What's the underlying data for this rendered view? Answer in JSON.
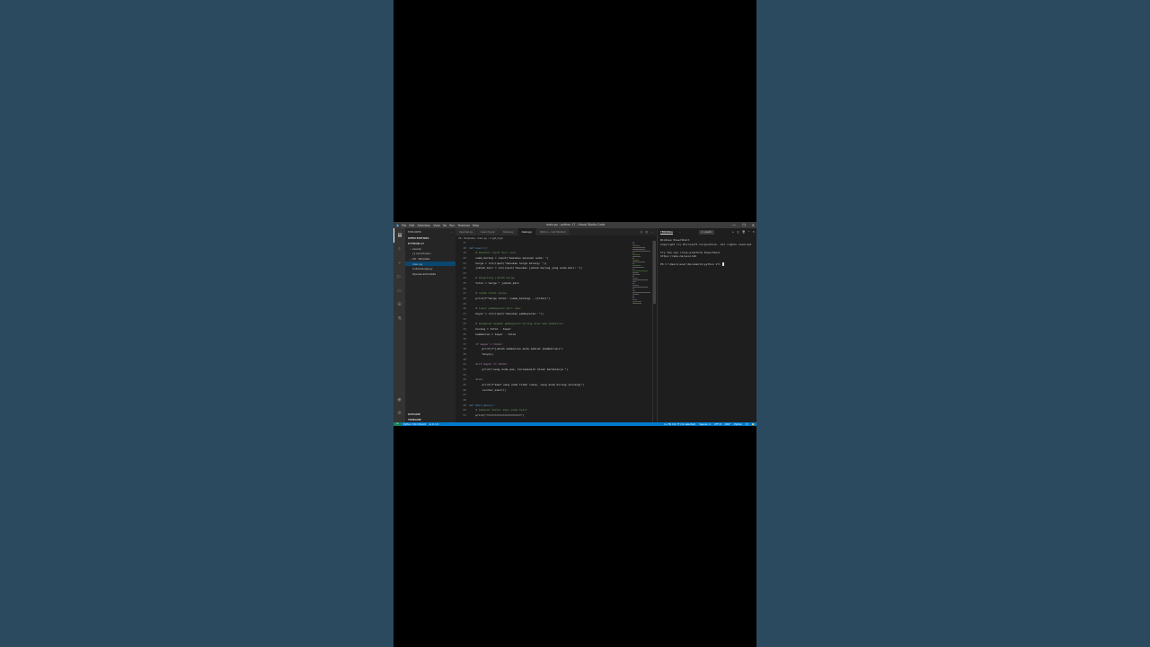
{
  "window": {
    "title": "main.py - python 17 - Visual Studio Code",
    "menu": [
      "File",
      "Edit",
      "Selection",
      "View",
      "Go",
      "Run",
      "Terminal",
      "Help"
    ],
    "controls": [
      "—",
      "❐",
      "✕"
    ]
  },
  "activity_bar": {
    "icons": [
      "explorer-icon",
      "search-icon",
      "source-control-icon",
      "run-debug-icon",
      "remote-explorer-icon",
      "extensions-icon",
      "testing-icon"
    ],
    "bottom_icons": [
      "account-icon",
      "gear-icon"
    ]
  },
  "sidebar": {
    "header": "EXPLORER",
    "header_action": "···",
    "sections": {
      "open_editors": "OPEN EDITORS",
      "workspace": "PYTHON 17",
      "outline": "OUTLINE",
      "timeline": "TIMELINE"
    },
    "tree": [
      {
        "label": "› .vscode",
        "selected": false
      },
      {
        "label": "{} launch.json",
        "selected": false
      },
      {
        "label": "⌄ 09 - Template",
        "selected": false
      },
      {
        "label": "main.py",
        "selected": true
      },
      {
        "label": "mulaimengai.py",
        "selected": false
      },
      {
        "label": "Operasi aritmatika",
        "selected": false
      }
    ]
  },
  "editor": {
    "tabs": [
      {
        "label": "desimal.py",
        "active": false
      },
      {
        "label": "launch.json",
        "active": false
      },
      {
        "label": "tabel.py",
        "active": false
      },
      {
        "label": "main.py",
        "active": true
      },
      {
        "label": "Python - Get Started",
        "active": false
      }
    ],
    "breadcrumb": "09 - Template › main.py › ⊙ get_login",
    "lines": [
      {
        "n": "17",
        "t": "",
        "c": "tx"
      },
      {
        "n": "18",
        "t": "def kasir():",
        "c": "df"
      },
      {
        "n": "19",
        "t": "    # masukan input dari user",
        "c": "cm"
      },
      {
        "n": "20",
        "t": "    nama_barang = input(\"masukan pesanan anda: \")",
        "c": "tx"
      },
      {
        "n": "21",
        "t": "    harga = int(input(\"masukan harga barang: \"))",
        "c": "tx"
      },
      {
        "n": "22",
        "t": "    jumlah_beli = int(input(\"masukan jumlah barang yang anda beli: \"))",
        "c": "tx"
      },
      {
        "n": "23",
        "t": "",
        "c": "tx"
      },
      {
        "n": "24",
        "t": "    # mengitung jumlah harga",
        "c": "cm"
      },
      {
        "n": "25",
        "t": "    total = harga * jumlah_beli",
        "c": "tx"
      },
      {
        "n": "26",
        "t": "",
        "c": "tx"
      },
      {
        "n": "27",
        "t": "    # cetak total harga",
        "c": "cm"
      },
      {
        "n": "28",
        "t": "    print(f\"harga total: {nama_barang} - {total}\")",
        "c": "tx"
      },
      {
        "n": "29",
        "t": "",
        "c": "tx"
      },
      {
        "n": "30",
        "t": "    # input pembayaran dari user",
        "c": "cm"
      },
      {
        "n": "31",
        "t": "    bayar = int(input(\"masukan pembayaran: \"))",
        "c": "tx"
      },
      {
        "n": "32",
        "t": "",
        "c": "tx"
      },
      {
        "n": "33",
        "t": "    # mengecek apakah pembayaran kurang atau ada kembalian",
        "c": "cm"
      },
      {
        "n": "34",
        "t": "    kurang = total - bayar",
        "c": "tx"
      },
      {
        "n": "35",
        "t": "    kembalian = bayar - total",
        "c": "tx"
      },
      {
        "n": "36",
        "t": "",
        "c": "tx"
      },
      {
        "n": "37",
        "t": "    if bayar > total:",
        "c": "kw"
      },
      {
        "n": "38",
        "t": "        print(f\"jumlah kembalian anda adalah {kembalian}\")",
        "c": "tx"
      },
      {
        "n": "39",
        "t": "        tanya()",
        "c": "tx"
      },
      {
        "n": "40",
        "t": "",
        "c": "tx"
      },
      {
        "n": "41",
        "t": "    elif bayar == total:",
        "c": "kw"
      },
      {
        "n": "42",
        "t": "        print(\"uang anda pas, terimakasih telah berbelanja \")",
        "c": "tx"
      },
      {
        "n": "43",
        "t": "",
        "c": "tx"
      },
      {
        "n": "44",
        "t": "    else:",
        "c": "kw"
      },
      {
        "n": "45",
        "t": "        print(f\"maaf uang anda tidak cukup, uang anda kurang {kurang}\")",
        "c": "tx"
      },
      {
        "n": "46",
        "t": "        counter_kasir()",
        "c": "tx"
      },
      {
        "n": "47",
        "t": "",
        "c": "tx"
      },
      {
        "n": "48",
        "t": "",
        "c": "tx"
      },
      {
        "n": "49",
        "t": "def main_menu():",
        "c": "df"
      },
      {
        "n": "50",
        "t": "    # membuat daftar menu pada kasir",
        "c": "cm"
      },
      {
        "n": "51",
        "t": "    print(\"=====================\")",
        "c": "tx"
      }
    ]
  },
  "panel": {
    "tab": "TERMINAL",
    "tab_more": "···",
    "terminal_name": "1: pwsh",
    "icons": [
      "+",
      "◫",
      "🗑",
      "⌃",
      "✕"
    ],
    "output": [
      "Windows PowerShell",
      "Copyright (C) Microsoft Corporation. All rights reserved.",
      "",
      "Try the new cross-platform PowerShell https://aka.ms/pscore6",
      "",
      "PS C:\\Users\\acer\\Documents\\python 17> "
    ]
  },
  "status_bar": {
    "remote": "⇆",
    "python": "Python 3.9.0 64-bit",
    "problems": "⊗ 0  ⚠ 0",
    "position": "Ln 78, Col 77 (11 selected)",
    "spaces": "Spaces: 4",
    "encoding": "UTF-8",
    "eol": "CRLF",
    "language": "Python",
    "feedback": "☺",
    "bell": "🔔"
  }
}
